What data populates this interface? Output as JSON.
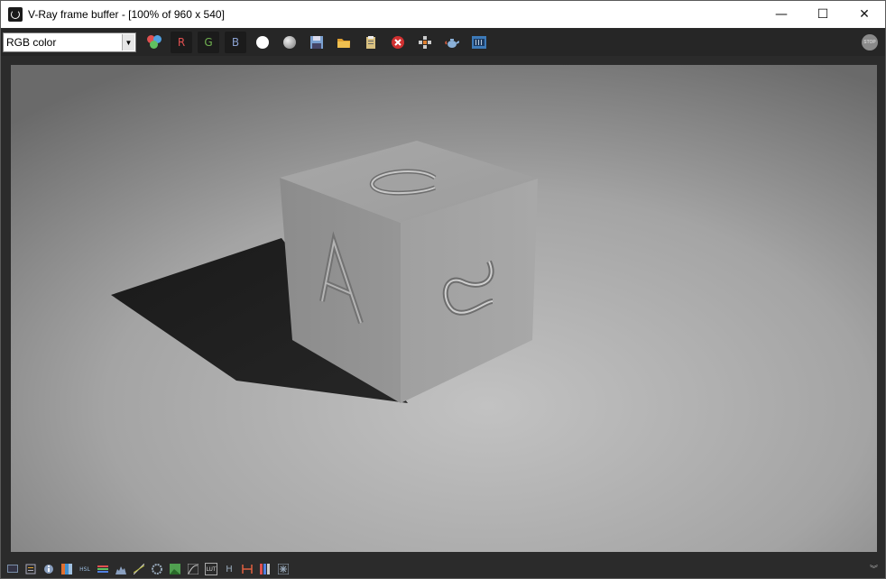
{
  "window": {
    "title": "V-Ray frame buffer - [100% of 960 x 540]",
    "controls": {
      "minimize": "—",
      "maximize": "☐",
      "close": "✕"
    }
  },
  "toolbar": {
    "channel_select": {
      "value": "RGB color",
      "arrow": "▼"
    },
    "buttons": [
      {
        "name": "rgb-channels-icon"
      },
      {
        "name": "red-channel-button",
        "label": "R",
        "color": "#e05050"
      },
      {
        "name": "green-channel-button",
        "label": "G",
        "color": "#70b050"
      },
      {
        "name": "blue-channel-button",
        "label": "B",
        "color": "#8aa0d0"
      },
      {
        "name": "white-circle-icon"
      },
      {
        "name": "grey-sphere-icon"
      },
      {
        "name": "save-icon"
      },
      {
        "name": "open-folder-icon"
      },
      {
        "name": "clipboard-icon"
      },
      {
        "name": "clear-image-icon"
      },
      {
        "name": "region-render-icon"
      },
      {
        "name": "teapot-render-icon"
      },
      {
        "name": "film-strip-icon"
      }
    ],
    "stop_label": "STOP"
  },
  "bottom_toolbar": {
    "icons": [
      "display-icon",
      "history-icon",
      "info-icon",
      "color-gradient-icon",
      "hsl-icon",
      "levels-icon",
      "histogram-icon",
      "curves-icon",
      "lens-effects-icon",
      "image-icon",
      "curve-editor-icon",
      "lut-icon",
      "h-icon",
      "compare-icon",
      "stripes-icon",
      "star-icon"
    ],
    "hsl_label": "HSL",
    "lut_label": "LUT",
    "h_label": "H",
    "expand_label": "︾"
  },
  "colors": {
    "toolbar_bg": "#262626",
    "background": "#2b2b2b"
  }
}
